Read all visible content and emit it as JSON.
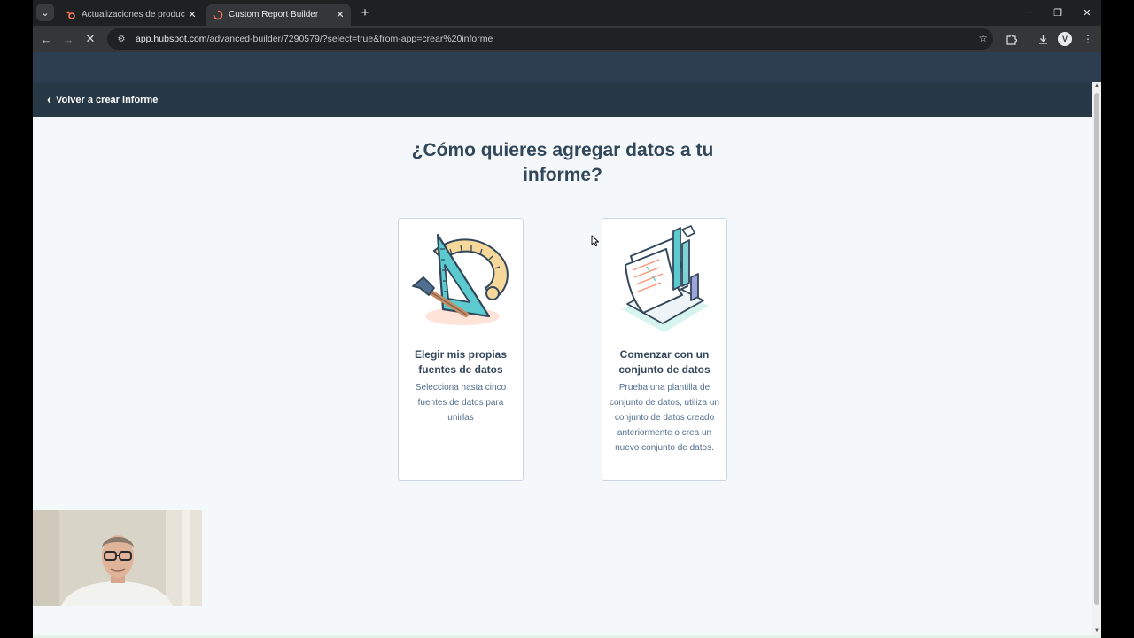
{
  "browser": {
    "tabs": [
      {
        "title": "Actualizaciones de productos |",
        "active": false,
        "favicon": "hubspot-sprocket-icon"
      },
      {
        "title": "Custom Report Builder",
        "active": true,
        "favicon": "loading-spinner-icon"
      }
    ],
    "url_host": "app.hubspot.com",
    "url_rest": "/advanced-builder/7290579/?select=true&from-app=crear%20informe",
    "profile_initial": "V"
  },
  "page": {
    "back_label": "Volver a crear informe",
    "heading": "¿Cómo quieres agregar datos a tu informe?",
    "options": [
      {
        "title": "Elegir mis propias fuentes de datos",
        "description": "Selecciona hasta cinco fuentes de datos para unirlas",
        "illustration": "ruler-hammer-icon"
      },
      {
        "title": "Comenzar con un conjunto de datos",
        "description": "Prueba una plantilla de conjunto de datos, utiliza un conjunto de datos creado anteriormente o crea un nuevo conjunto de datos.",
        "illustration": "document-chart-icon"
      }
    ]
  },
  "colors": {
    "header": "#273847",
    "heading_text": "#33475b",
    "card_border": "#cbd6e2",
    "accent_teal": "#5ccbcf",
    "accent_tan": "#f5d89a"
  }
}
